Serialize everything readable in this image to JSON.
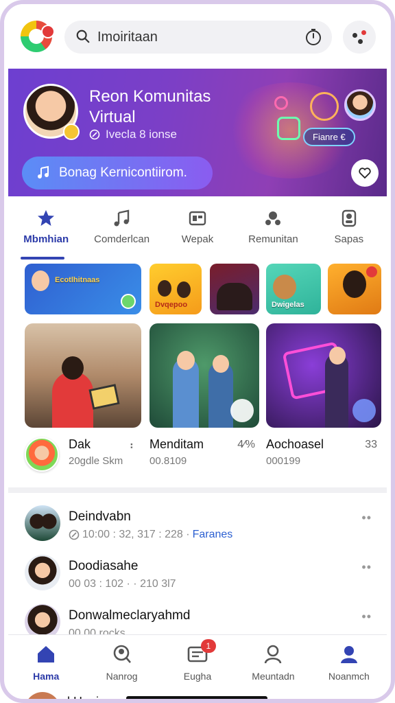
{
  "search": {
    "value": "Imoiritaan"
  },
  "hero": {
    "title": "Reon Komunitas Virtual",
    "meta": "Ivecla 8 ionse",
    "cta": "Bonag Kernicontiirom.",
    "tag": "Fianre €"
  },
  "tabs": [
    {
      "label": "Mbmhian"
    },
    {
      "label": "Comderlcan"
    },
    {
      "label": "Wepak"
    },
    {
      "label": "Remunitan"
    },
    {
      "label": "Sapas"
    }
  ],
  "stories": [
    {
      "text": "Ecotlhitnaas"
    },
    {
      "text": "Dvqepoo"
    },
    {
      "text": ""
    },
    {
      "text": "Dwigelas"
    },
    {
      "text": ""
    }
  ],
  "cards": [
    {
      "title": "Dak",
      "sub": "20gdle Skm",
      "stat": "⠆"
    },
    {
      "title": "Menditam",
      "sub": "00.8109",
      "stat": "4⁄%"
    },
    {
      "title": "Aochoasel",
      "sub": "000199",
      "stat": "33"
    }
  ],
  "list": [
    {
      "title": "Deindvabn",
      "sub": "10:00 : 32, 317 : 228 ·",
      "link": "Faranes"
    },
    {
      "title": "Doodiasahe",
      "sub": "00 03 : 102 · · 210 3l7",
      "link": ""
    },
    {
      "title": "Donwalmeclaryahmd",
      "sub": "00 00 rocks",
      "link": ""
    }
  ],
  "peek": {
    "text": "l Hunie..."
  },
  "nav": [
    {
      "label": "Hama"
    },
    {
      "label": "Nanrog"
    },
    {
      "label": "Eugha",
      "badge": "1"
    },
    {
      "label": "Meuntadn"
    },
    {
      "label": "Noanmch"
    }
  ],
  "colors": {
    "accent": "#3344b3",
    "hero_start": "#6d3fd0",
    "badge": "#e23a3a"
  }
}
